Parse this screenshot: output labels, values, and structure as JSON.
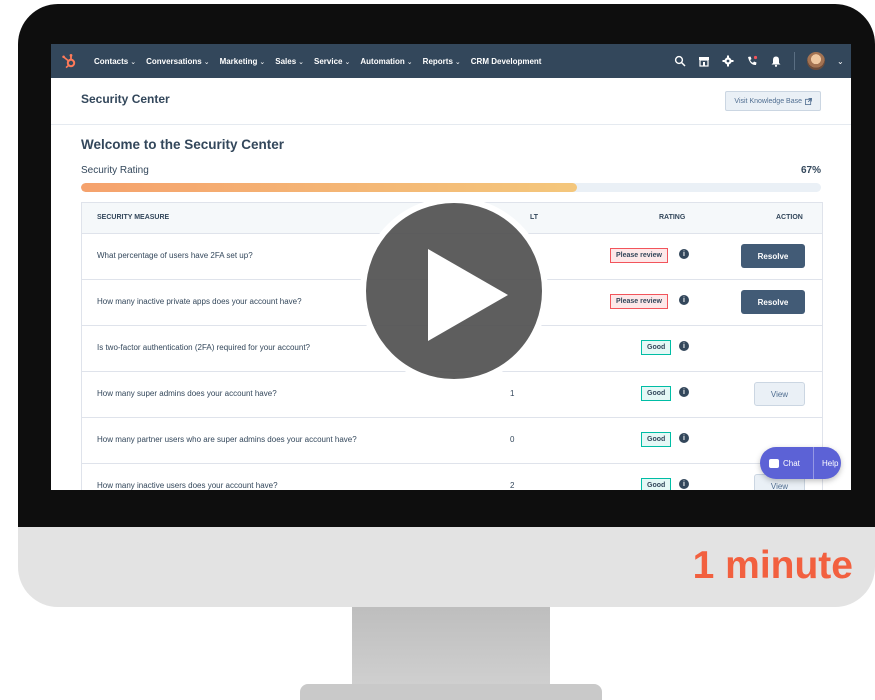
{
  "nav": {
    "items": [
      {
        "label": "Contacts",
        "has_menu": true
      },
      {
        "label": "Conversations",
        "has_menu": true
      },
      {
        "label": "Marketing",
        "has_menu": true
      },
      {
        "label": "Sales",
        "has_menu": true
      },
      {
        "label": "Service",
        "has_menu": true
      },
      {
        "label": "Automation",
        "has_menu": true
      },
      {
        "label": "Reports",
        "has_menu": true
      },
      {
        "label": "CRM Development",
        "has_menu": false
      }
    ],
    "icons": [
      "search-icon",
      "marketplace-icon",
      "settings-gear-icon",
      "calling-icon",
      "notifications-bell-icon"
    ],
    "chevron": "⌄"
  },
  "header": {
    "title": "Security Center",
    "knowledge_base_label": "Visit Knowledge Base"
  },
  "main": {
    "welcome_title": "Welcome to the Security Center",
    "rating_label": "Security Rating",
    "rating_percent_text": "67%",
    "rating_fraction": 0.67
  },
  "table": {
    "columns": {
      "measure": "SECURITY MEASURE",
      "result_partial": "LT",
      "rating": "RATING",
      "action": "ACTION"
    },
    "rows": [
      {
        "question": "What percentage of users have 2FA set up?",
        "result": "",
        "rating": "Please review",
        "rating_type": "review",
        "action": "Resolve"
      },
      {
        "question": "How many inactive private apps does your account have?",
        "result": "",
        "rating": "Please review",
        "rating_type": "review",
        "action": "Resolve"
      },
      {
        "question": "Is two-factor authentication (2FA) required for your account?",
        "result": "",
        "rating": "Good",
        "rating_type": "good",
        "action": ""
      },
      {
        "question": "How many super admins does your account have?",
        "result": "1",
        "rating": "Good",
        "rating_type": "good",
        "action": "View"
      },
      {
        "question": "How many partner users who are super admins does your account have?",
        "result": "0",
        "rating": "Good",
        "rating_type": "good",
        "action": ""
      },
      {
        "question": "How many inactive users does your account have?",
        "result": "2",
        "rating": "Good",
        "rating_type": "good",
        "action": "View"
      }
    ]
  },
  "chat": {
    "chat_label": "Chat",
    "help_label": "Help"
  },
  "video": {
    "duration": "1 minute",
    "accent": "#f2603f"
  },
  "colors": {
    "nav_bg": "#33475b",
    "resolve_bg": "#425b76",
    "chat_bg": "#5c62d6"
  }
}
